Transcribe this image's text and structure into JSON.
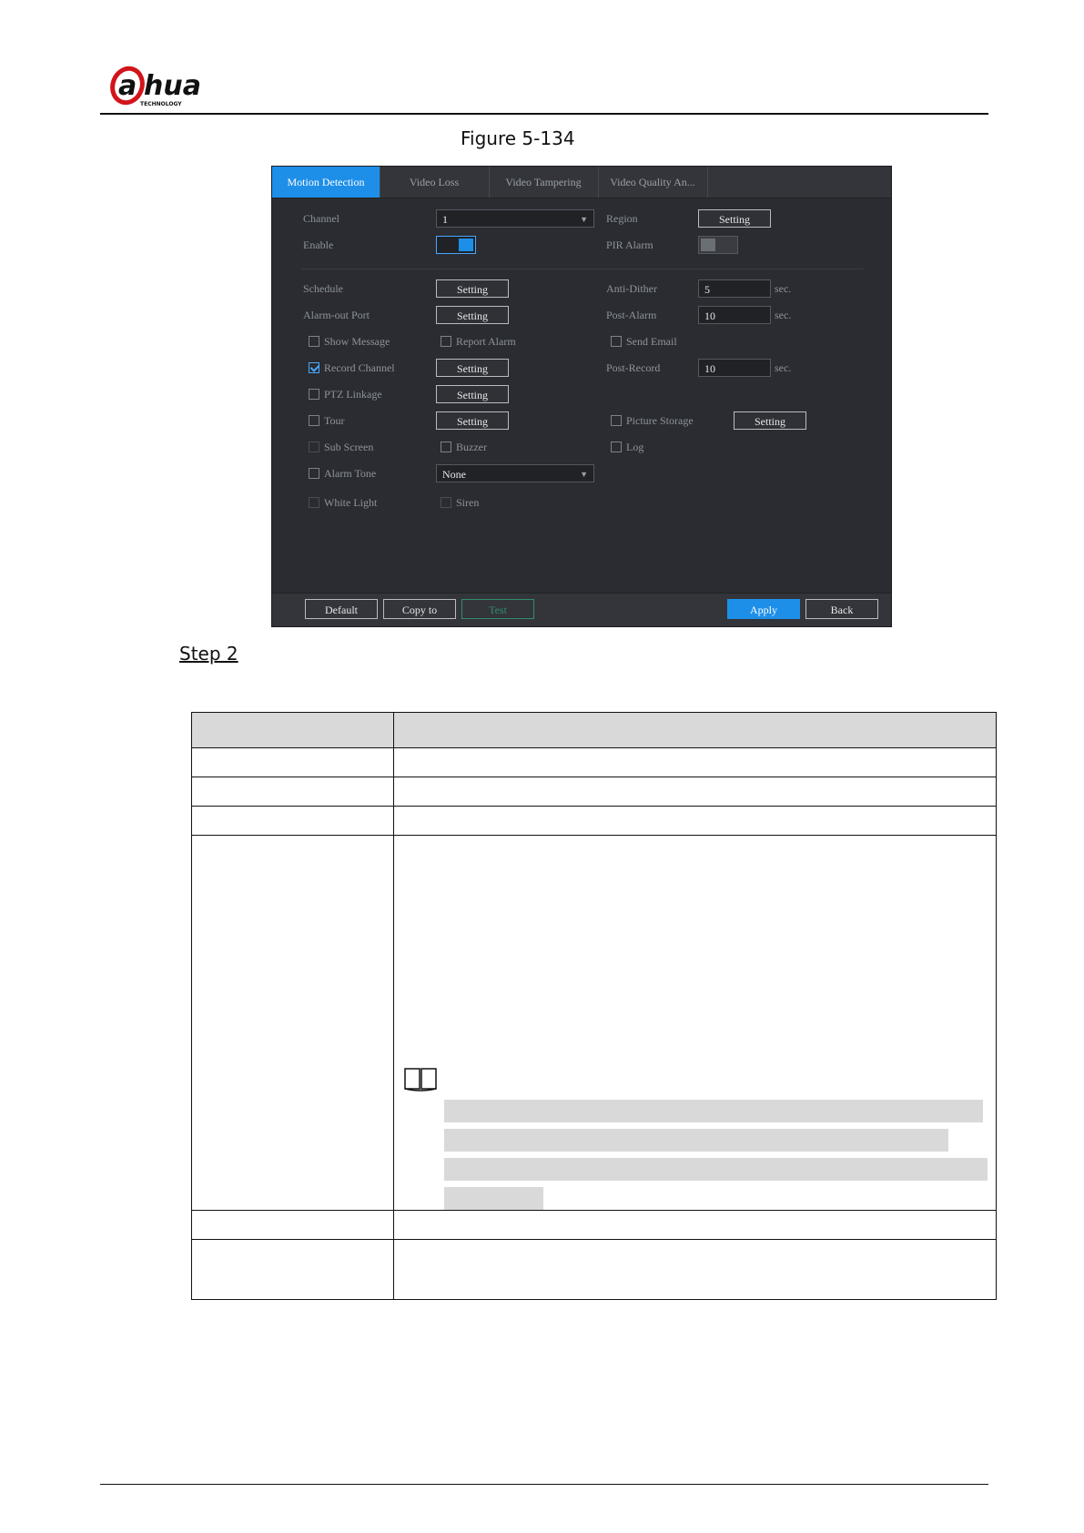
{
  "header": {
    "logo_text": "alhua",
    "logo_sub": "TECHNOLOGY"
  },
  "figure": {
    "caption": "Figure 5-134"
  },
  "ui": {
    "tabs": [
      "Motion Detection",
      "Video Loss",
      "Video Tampering",
      "Video Quality An..."
    ],
    "fields": {
      "channel_label": "Channel",
      "channel_value": "1",
      "region_label": "Region",
      "region_button": "Setting",
      "enable_label": "Enable",
      "pir_alarm_label": "PIR Alarm",
      "schedule_label": "Schedule",
      "schedule_button": "Setting",
      "anti_dither_label": "Anti-Dither",
      "anti_dither_value": "5",
      "anti_dither_unit": "sec.",
      "alarm_out_label": "Alarm-out Port",
      "alarm_out_button": "Setting",
      "post_alarm_label": "Post-Alarm",
      "post_alarm_value": "10",
      "post_alarm_unit": "sec.",
      "show_message_label": "Show Message",
      "report_alarm_label": "Report Alarm",
      "send_email_label": "Send Email",
      "record_channel_label": "Record Channel",
      "record_channel_button": "Setting",
      "post_record_label": "Post-Record",
      "post_record_value": "10",
      "post_record_unit": "sec.",
      "ptz_linkage_label": "PTZ Linkage",
      "ptz_linkage_button": "Setting",
      "tour_label": "Tour",
      "tour_button": "Setting",
      "picture_storage_label": "Picture Storage",
      "picture_storage_button": "Setting",
      "sub_screen_label": "Sub Screen",
      "buzzer_label": "Buzzer",
      "log_label": "Log",
      "alarm_tone_label": "Alarm Tone",
      "alarm_tone_value": "None",
      "white_light_label": "White Light",
      "siren_label": "Siren"
    },
    "buttons": {
      "default": "Default",
      "copy_to": "Copy to",
      "test": "Test",
      "apply": "Apply",
      "back": "Back"
    }
  },
  "step": {
    "label": "Step 2"
  }
}
